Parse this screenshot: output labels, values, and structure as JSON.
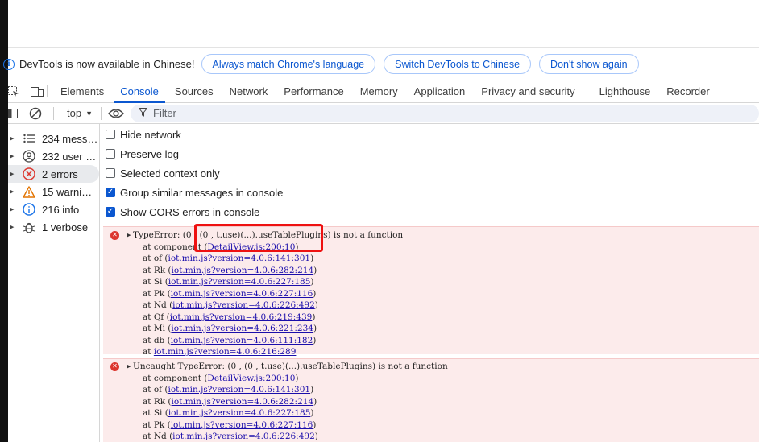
{
  "infobar": {
    "message": "DevTools is now available in Chinese!",
    "buttons": [
      "Always match Chrome's language",
      "Switch DevTools to Chinese",
      "Don't show again"
    ]
  },
  "tabs": [
    "Elements",
    "Console",
    "Sources",
    "Network",
    "Performance",
    "Memory",
    "Application",
    "Privacy and security",
    "Lighthouse",
    "Recorder"
  ],
  "active_tab": "Console",
  "toolbar": {
    "context": "top",
    "filter_placeholder": "Filter"
  },
  "sidebar": {
    "items": [
      {
        "label": "234 mess…",
        "icon": "list-icon"
      },
      {
        "label": "232 user …",
        "icon": "user-icon"
      },
      {
        "label": "2 errors",
        "icon": "error-icon"
      },
      {
        "label": "15 warni…",
        "icon": "warning-icon"
      },
      {
        "label": "216 info",
        "icon": "info-icon"
      },
      {
        "label": "1 verbose",
        "icon": "bug-icon"
      }
    ]
  },
  "settings": {
    "options": [
      {
        "label": "Hide network",
        "checked": false
      },
      {
        "label": "Preserve log",
        "checked": false
      },
      {
        "label": "Selected context only",
        "checked": false
      },
      {
        "label": "Group similar messages in console",
        "checked": true
      },
      {
        "label": "Show CORS errors in console",
        "checked": true
      }
    ]
  },
  "errors": [
    {
      "message": "TypeError: (0 , (0 , t.use)(...).useTablePlugins) is not a function",
      "stack": [
        {
          "prefix": "at component (",
          "link": "DetailView.js:200:10",
          "suffix": ")"
        },
        {
          "prefix": "at of (",
          "link": "iot.min.js?version=4.0.6:141:301",
          "suffix": ")"
        },
        {
          "prefix": "at Rk (",
          "link": "iot.min.js?version=4.0.6:282:214",
          "suffix": ")"
        },
        {
          "prefix": "at Si (",
          "link": "iot.min.js?version=4.0.6:227:185",
          "suffix": ")"
        },
        {
          "prefix": "at Pk (",
          "link": "iot.min.js?version=4.0.6:227:116",
          "suffix": ")"
        },
        {
          "prefix": "at Nd (",
          "link": "iot.min.js?version=4.0.6:226:492",
          "suffix": ")"
        },
        {
          "prefix": "at Qf (",
          "link": "iot.min.js?version=4.0.6:219:439",
          "suffix": ")"
        },
        {
          "prefix": "at Mi (",
          "link": "iot.min.js?version=4.0.6:221:234",
          "suffix": ")"
        },
        {
          "prefix": "at db (",
          "link": "iot.min.js?version=4.0.6:111:182",
          "suffix": ")"
        },
        {
          "prefix": "at ",
          "link": "iot.min.js?version=4.0.6:216:289",
          "suffix": ""
        }
      ]
    },
    {
      "message": "Uncaught TypeError: (0 , (0 , t.use)(...).useTablePlugins) is not a function",
      "stack": [
        {
          "prefix": "at component (",
          "link": "DetailView.js:200:10",
          "suffix": ")"
        },
        {
          "prefix": "at of (",
          "link": "iot.min.js?version=4.0.6:141:301",
          "suffix": ")"
        },
        {
          "prefix": "at Rk (",
          "link": "iot.min.js?version=4.0.6:282:214",
          "suffix": ")"
        },
        {
          "prefix": "at Si (",
          "link": "iot.min.js?version=4.0.6:227:185",
          "suffix": ")"
        },
        {
          "prefix": "at Pk (",
          "link": "iot.min.js?version=4.0.6:227:116",
          "suffix": ")"
        },
        {
          "prefix": "at Nd (",
          "link": "iot.min.js?version=4.0.6:226:492",
          "suffix": ")"
        }
      ]
    }
  ],
  "colors": {
    "accent": "#0b57d0",
    "error_bg": "#fcebeb",
    "error_icon": "#dc362e",
    "highlight_box": "#ee1111"
  }
}
